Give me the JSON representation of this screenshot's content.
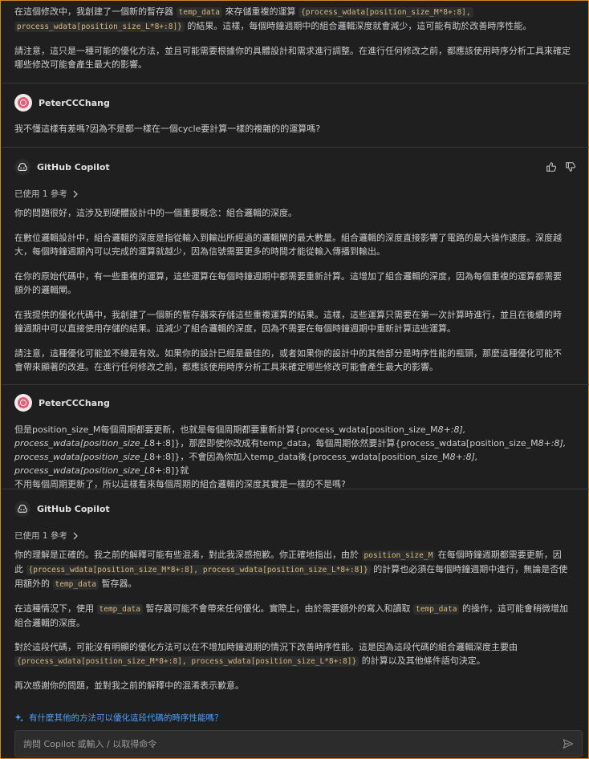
{
  "msg0": {
    "p1_a": "在這個修改中，我創建了一個新的暫存器",
    "p1_code1": "temp_data",
    "p1_b": "來存儲重複的運算",
    "p1_code2": "{process_wdata[position_size_M*8+:8],",
    "p1_code3": "process_wdata[position_size_L*8+:8]}",
    "p1_c": "的結果。這樣，每個時鐘週期中的組合邏輯深度就會減少，這可能有助於改善時序性能。",
    "p2": "請注意，這只是一種可能的優化方法，並且可能需要根據你的具體設計和需求進行調整。在進行任何修改之前，都應該使用時序分析工具來確定哪些修改可能會產生最大的影響。"
  },
  "user1": {
    "name": "PeterCCChang",
    "text": "我不懂這樣有差嗎?因為不是都一樣在一個cycle要計算一樣的複雜的的運算嗎?"
  },
  "bot1": {
    "name": "GitHub Copilot",
    "refs": "已使用 1 參考",
    "p1": "你的問題很好，這涉及到硬體設計中的一個重要概念：組合邏輯的深度。",
    "p2a": "在數位邏輯設計中，組合邏輯的深度是指從輸入到輸出所經過的邏輯閘的最大數量。組合邏輯的深度直接影響了電路的最大操作速度。深度越",
    "p2b": "大，每個時鐘週期內可以完成的運算就越少，因為信號需要更多的時間才能從輸入傳播到輸出。",
    "p3a": "在你的原始代碼中，有一些重複的運算，這些運算在每個時鐘週期中都需要重新計算。這增加了組合邏輯的深度，因為每個重複的運算都需要",
    "p3b": "額外的邏輯閘。",
    "p4a": "在我提供的優化代碼中，我創建了一個新的暫存器來存儲這些重複運算的結果。這樣，這些運算只需要在第一次計算時進行，並且在後續的時",
    "p4b": "鐘週期中可以直接使用存儲的結果。這減少了組合邏輯的深度，因為不需要在每個時鐘週期中重新計算這些運算。",
    "p5a": "請注意，這種優化可能並不總是有效。如果你的設計已經是最佳的，或者如果你的設計中的其他部分是時序性能的瓶頸，那麼這種優化可能不",
    "p5b": "會帶來顯著的改進。在進行任何修改之前，都應該使用時序分析工具來確定哪些修改可能會產生最大的影響。"
  },
  "user2": {
    "name": "PeterCCChang",
    "l1a": "但是position_size_M每個周期都要更新，也就是每個周期都要重新計算{process_wdata[position_size_M",
    "l1b": "8+:8],",
    "l2a": "process_wdata[position_size_L",
    "l2b": "8+:8]}，那麼即使你改成有temp_data，每個周期依然要計算{process_wdata[position_size_M",
    "l2c": "8+:8],",
    "l3a": "process_wdata[position_size_L",
    "l3b": "8+:8]}，不會因為你加入temp_data後{process_wdata[position_size_M",
    "l3c": "8+:8], process_wdata[position_size_L",
    "l3d": "8+:8]}就",
    "l4": "不用每個周期更新了，所以這樣看來每個周期的組合邏輯的深度其實是一樣的不是嗎?"
  },
  "bot2": {
    "name": "GitHub Copilot",
    "refs": "已使用 1 參考",
    "p1a": "你的理解是正確的。我之前的解釋可能有些混淆，對此我深感抱歉。你正確地指出，由於",
    "p1code1": "position_size_M",
    "p1b": "在每個時鐘週期都需要更新，因",
    "p1c": "此",
    "p1code2": "{process_wdata[position_size_M*8+:8], process_wdata[position_size_L*8+:8]}",
    "p1d": "的計算也必須在每個時鐘週期中進行，無論是否使",
    "p1e": "用額外的",
    "p1code3": "temp_data",
    "p1f": "暫存器。",
    "p2a": "在這種情況下，使用",
    "p2code1": "temp_data",
    "p2b": "暫存器可能不會帶來任何優化。實際上，由於需要額外的寫入和讀取",
    "p2code2": "temp_data",
    "p2c": "的操作，這可能會稍微增加",
    "p2d": "組合邏輯的深度。",
    "p3a": "對於這段代碼，可能沒有明顯的優化方法可以在不增加時鐘週期的情況下改善時序性能。這是因為這段代碼的組合邏輯深度主要由",
    "p3code": "{process_wdata[position_size_M*8+:8], process_wdata[position_size_L*8+:8]}",
    "p3b": "的計算以及其他條件語句決定。",
    "p4": "再次感謝你的問題，並對我之前的解釋中的混淆表示歉意。"
  },
  "suggestion": "有什麼其他的方法可以優化這段代碼的時序性能嗎？",
  "input": {
    "placeholder": "詢問 Copilot 或輸入 / 以取得命令"
  }
}
